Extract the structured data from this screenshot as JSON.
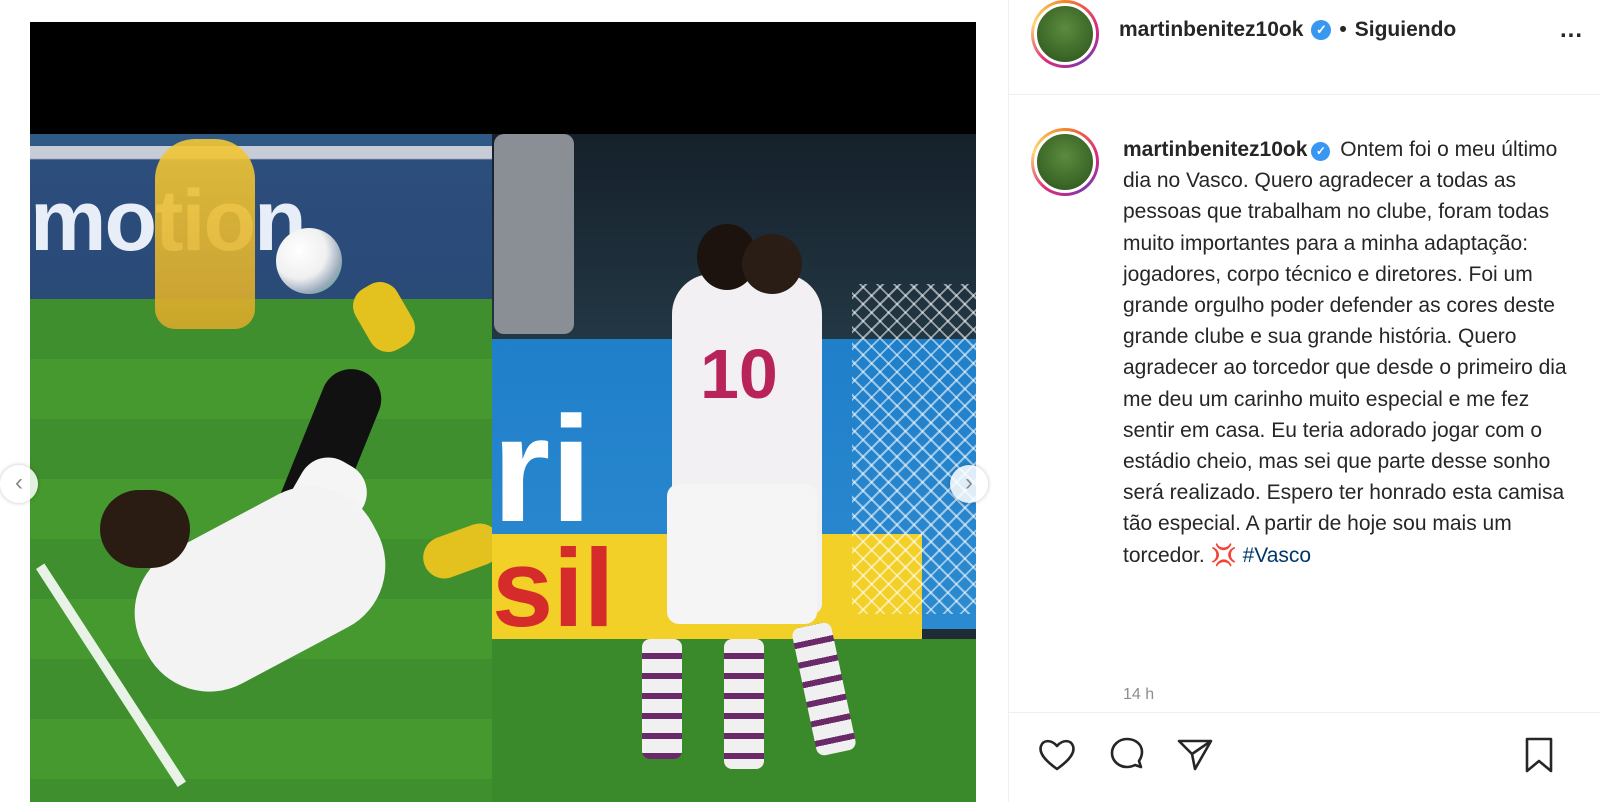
{
  "post": {
    "username": "martinbenitez10ok",
    "follow_separator": "•",
    "follow_status": "Siguiendo",
    "more_label": "...",
    "caption_text": "Ontem foi o meu último dia no Vasco. Quero agradecer a todas as pessoas que trabalham no clube, foram todas muito importantes para a minha adaptação: jogadores, corpo técnico e diretores. Foi um grande orgulho poder defender as cores deste grande clube e sua grande história. Quero agradecer ao torcedor que desde o primeiro dia me deu um carinho muito especial e me fez sentir em casa. Eu teria adorado jogar com o estádio cheio, mas sei que parte desse sonho será realizado. Espero ter honrado esta camisa tão especial. A partir de hoje sou mais um torcedor.",
    "caption_emoji": "💢",
    "hashtag": "#Vasco",
    "timestamp": "14 h"
  },
  "media": {
    "left_board_text": "motion",
    "right_board_text": "ri",
    "right_yellow_text": "sil",
    "jersey_number": "10",
    "prev_label": "‹",
    "next_label": "›"
  },
  "icons": {
    "verified": "verified-badge-icon",
    "like": "heart-icon",
    "comment": "comment-icon",
    "share": "paper-plane-icon",
    "save": "bookmark-icon"
  },
  "colors": {
    "verified": "#3897f0",
    "hashtag": "#00376b",
    "muted": "#8e8e8e"
  }
}
